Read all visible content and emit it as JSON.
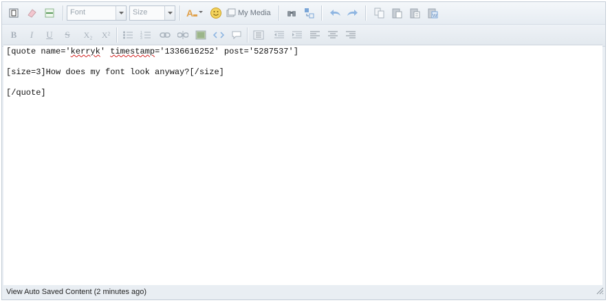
{
  "toolbar": {
    "font_label": "Font",
    "size_label": "Size",
    "my_media_label": "My Media",
    "format_buttons": {
      "bold": "B",
      "italic": "I",
      "underline": "U",
      "strike": "S",
      "subscript": "X₂",
      "superscript": "X²"
    }
  },
  "content": {
    "line1_a": "[quote name='",
    "line1_user": "kerryk",
    "line1_b": "' ",
    "line1_ts": "timestamp",
    "line1_c": "='1336616252' post='5287537']",
    "line2": "[size=3]How does my font look anyway?[/size]",
    "line3": "[/quote]"
  },
  "status_bar": {
    "autosave_text": "View Auto Saved Content (2 minutes ago)"
  },
  "colors": {
    "icon_blue": "#7aa6d8",
    "icon_gray": "#a9b3bd",
    "smiley": "#e3b72a",
    "squiggle": "#d21f1f"
  }
}
